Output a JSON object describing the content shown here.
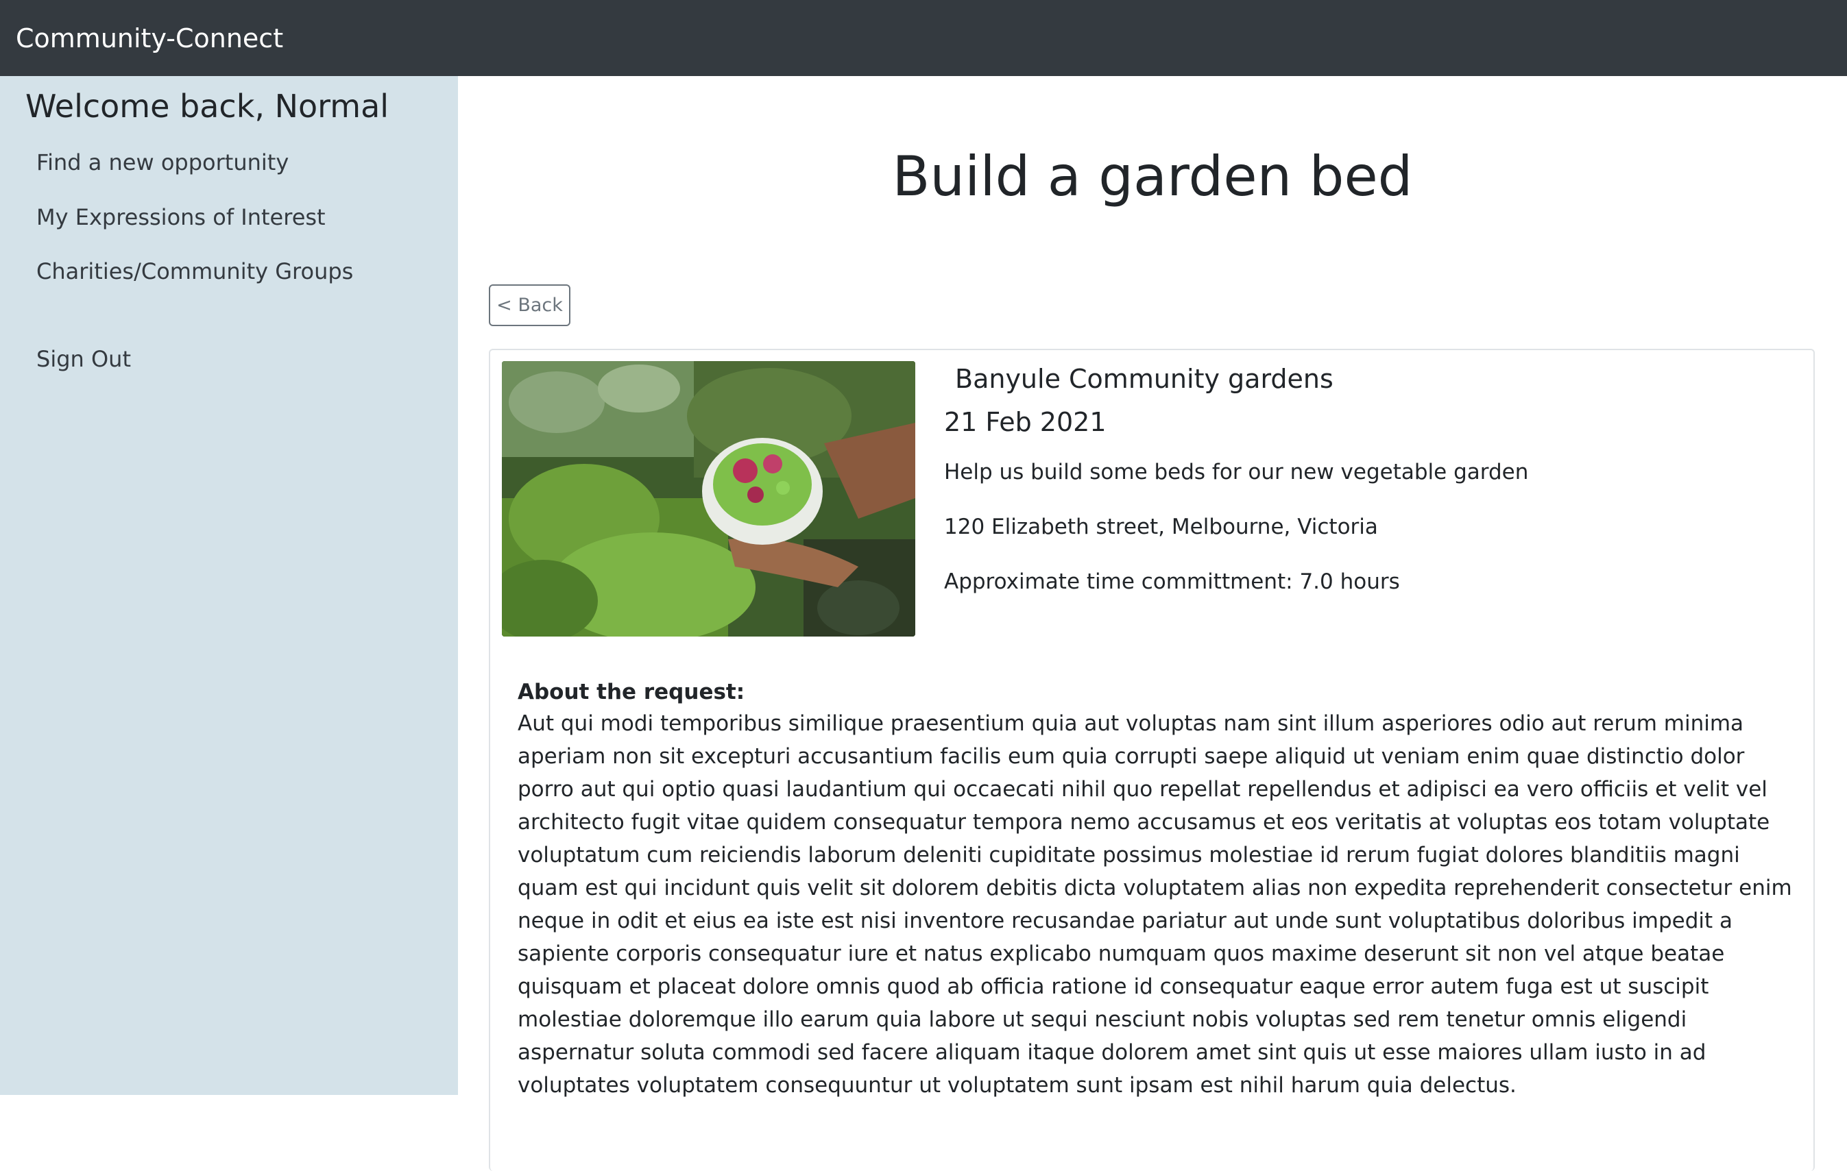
{
  "app": {
    "brand": "Community-Connect"
  },
  "sidebar": {
    "welcome": "Welcome back, Normal",
    "items": [
      {
        "label": "Find a new opportunity"
      },
      {
        "label": "My Expressions of Interest"
      },
      {
        "label": "Charities/Community Groups"
      },
      {
        "label": "Sign Out"
      }
    ]
  },
  "page": {
    "title": "Build a garden bed",
    "back_label": "< Back"
  },
  "opportunity": {
    "organisation": "Banyule Community gardens",
    "date": "21 Feb 2021",
    "summary": "Help us build some beds for our new vegetable garden",
    "address": "120 Elizabeth street, Melbourne, Victoria",
    "time_commitment": "Approximate time committment: 7.0 hours",
    "about_label": "About the request:",
    "about_text": "Aut qui modi temporibus similique praesentium quia aut voluptas nam sint illum asperiores odio aut rerum minima aperiam non sit excepturi accusantium facilis eum quia corrupti saepe aliquid ut veniam enim quae distinctio dolor porro aut qui optio quasi laudantium qui occaecati nihil quo repellat repellendus et adipisci ea vero officiis et velit vel architecto fugit vitae quidem consequatur tempora nemo accusamus et eos veritatis at voluptas eos totam voluptate voluptatum cum reiciendis laborum deleniti cupiditate possimus molestiae id rerum fugiat dolores blanditiis magni quam est qui incidunt quis velit sit dolorem debitis dicta voluptatem alias non expedita reprehenderit consectetur enim neque in odit et eius ea iste est nisi inventore recusandae pariatur aut unde sunt voluptatibus doloribus impedit a sapiente corporis consequatur iure et natus explicabo numquam quos maxime deserunt sit non vel atque beatae quisquam et placeat dolore omnis quod ab officia ratione id consequatur eaque error autem fuga est ut suscipit molestiae doloremque illo earum quia labore ut sequi nesciunt nobis voluptas sed rem tenetur omnis eligendi aspernatur soluta commodi sed facere aliquam itaque dolorem amet sint quis ut esse maiores ullam iusto in ad voluptates voluptatem consequuntur ut voluptatem sunt ipsam est nihil harum quia delectus."
  },
  "colors": {
    "navbar": "#343a40",
    "sidebar": "#d4e2e9",
    "text": "#212529",
    "muted": "#6c757d"
  }
}
